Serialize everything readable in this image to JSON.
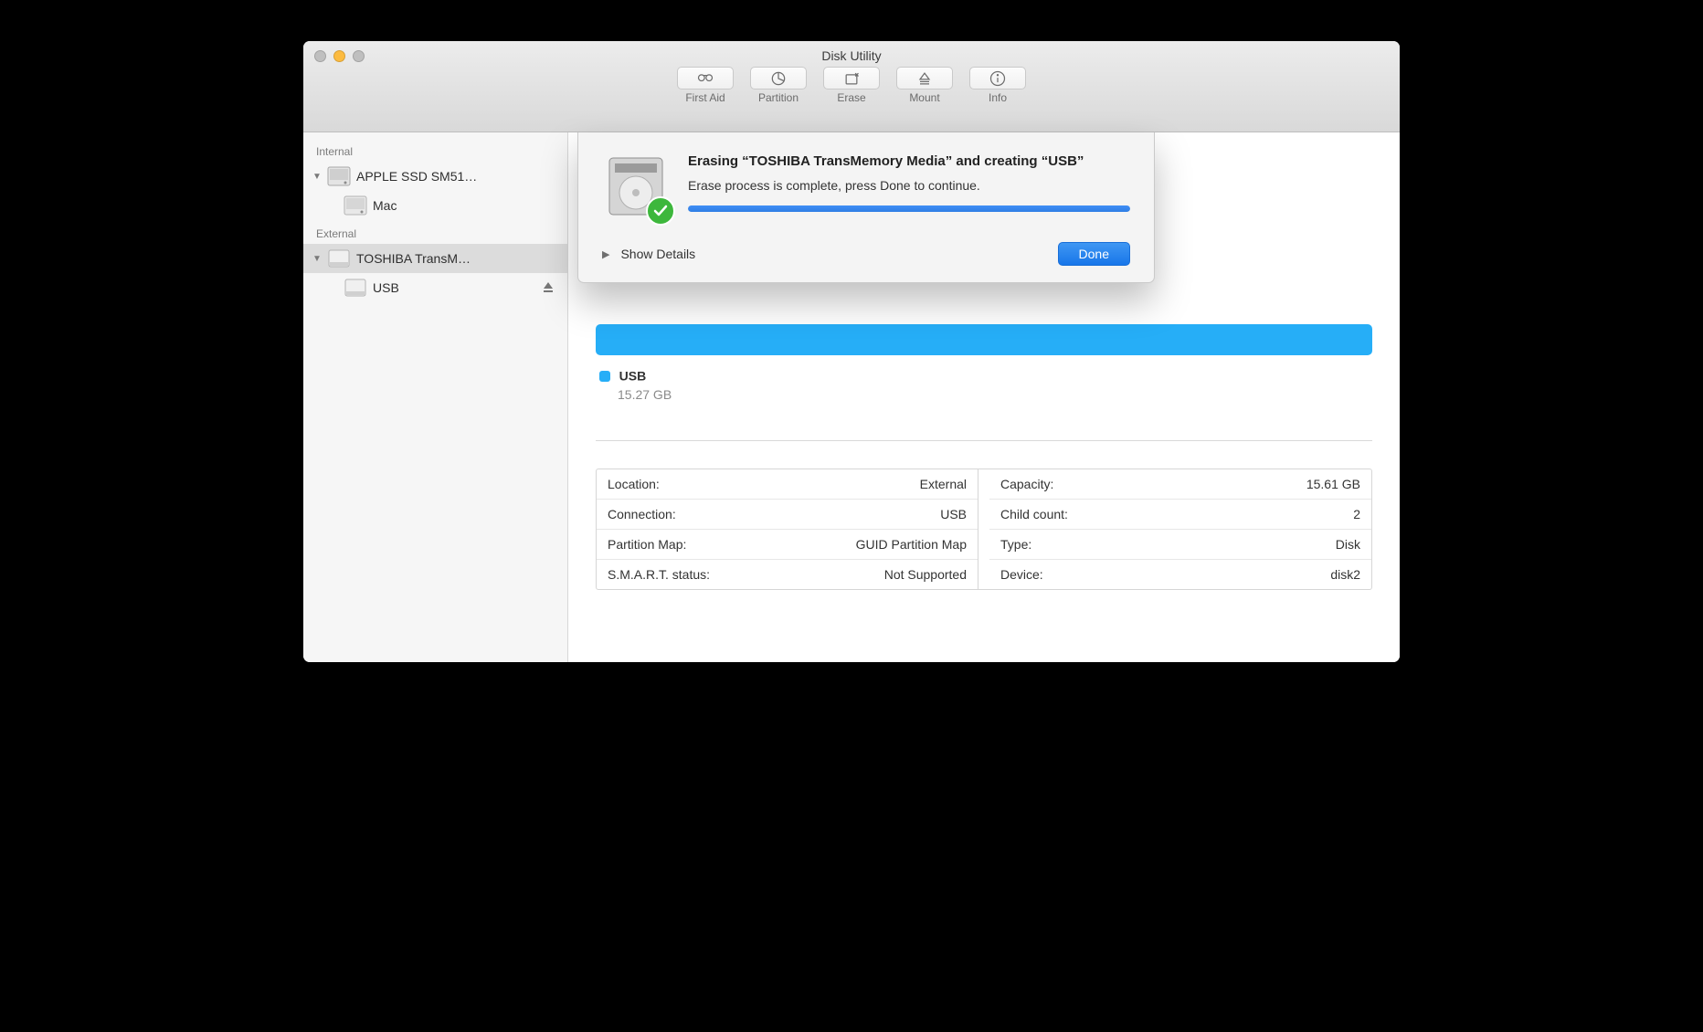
{
  "window": {
    "title": "Disk Utility"
  },
  "toolbar": {
    "first_aid": "First Aid",
    "partition": "Partition",
    "erase": "Erase",
    "mount": "Mount",
    "info": "Info"
  },
  "sidebar": {
    "section_internal": "Internal",
    "section_external": "External",
    "internal": [
      {
        "label": "APPLE SSD SM51…",
        "children": [
          {
            "label": "Mac"
          }
        ]
      }
    ],
    "external": [
      {
        "label": "TOSHIBA TransM…",
        "children": [
          {
            "label": "USB"
          }
        ]
      }
    ]
  },
  "main": {
    "volume_name": "USB",
    "volume_size": "15.27 GB",
    "info_left": [
      {
        "key": "Location:",
        "val": "External"
      },
      {
        "key": "Connection:",
        "val": "USB"
      },
      {
        "key": "Partition Map:",
        "val": "GUID Partition Map"
      },
      {
        "key": "S.M.A.R.T. status:",
        "val": "Not Supported"
      }
    ],
    "info_right": [
      {
        "key": "Capacity:",
        "val": "15.61 GB"
      },
      {
        "key": "Child count:",
        "val": "2"
      },
      {
        "key": "Type:",
        "val": "Disk"
      },
      {
        "key": "Device:",
        "val": "disk2"
      }
    ]
  },
  "dialog": {
    "title": "Erasing “TOSHIBA TransMemory Media” and creating “USB”",
    "subtitle": "Erase process is complete, press Done to continue.",
    "show_details": "Show Details",
    "done": "Done"
  }
}
